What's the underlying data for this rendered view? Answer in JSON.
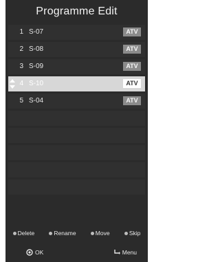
{
  "window": {
    "title": "Programme Edit"
  },
  "channels": [
    {
      "number": "1",
      "name": "S-07",
      "type": "ATV"
    },
    {
      "number": "2",
      "name": "S-08",
      "type": "ATV"
    },
    {
      "number": "3",
      "name": "S-09",
      "type": "ATV"
    },
    {
      "number": "4",
      "name": "S-10",
      "type": "ATV"
    },
    {
      "number": "5",
      "name": "S-04",
      "type": "ATV"
    }
  ],
  "footer": {
    "hints": [
      "Delete",
      "Rename",
      "Move",
      "Skip"
    ],
    "ok_label": "OK",
    "menu_label": "Menu"
  },
  "colors": {
    "panel": "#2b2b2b",
    "row": "#303030",
    "row_highlight": "#d7d7d7",
    "badge": "#8b8b8b"
  },
  "icons": {
    "move": "up-down-arrows-icon",
    "ok": "ok-circle-icon",
    "menu": "menu-return-icon"
  }
}
